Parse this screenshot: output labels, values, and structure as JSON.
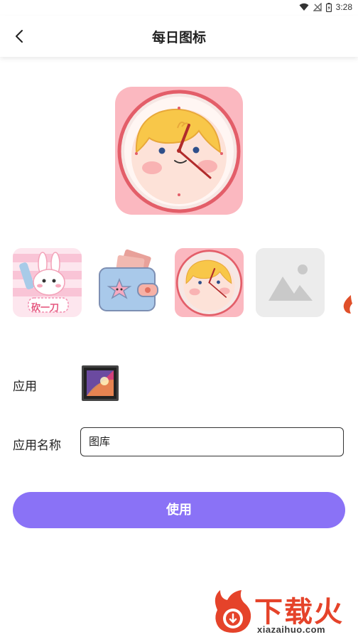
{
  "status": {
    "time": "3:28"
  },
  "appbar": {
    "title": "每日图标",
    "back_icon": "back-arrow-icon"
  },
  "icons": [
    {
      "name": "bunny-icon",
      "text": "砍一刀"
    },
    {
      "name": "wallet-icon"
    },
    {
      "name": "clock-face-icon"
    },
    {
      "name": "placeholder-image-icon"
    }
  ],
  "form": {
    "app_label": "应用",
    "app_name_label": "应用名称",
    "app_name_value": "图库"
  },
  "actions": {
    "use_label": "使用"
  },
  "watermark": {
    "text": "下载火",
    "url": "xiazaihuo.com"
  },
  "colors": {
    "accent": "#8a72f6",
    "preview_bg": "#fbb8c0",
    "watermark": "#e5432a"
  }
}
